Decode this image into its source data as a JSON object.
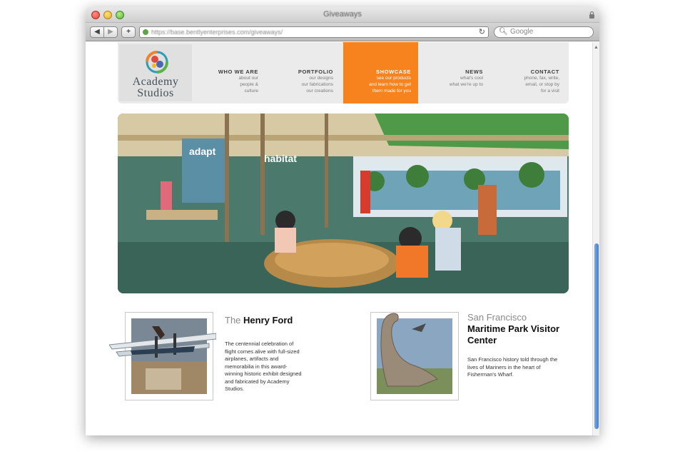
{
  "browser": {
    "window_title": "Giveaways",
    "url": "https://base.bentlyenterprises.com/giveaways/",
    "search_placeholder": "Google",
    "back_glyph": "◀",
    "forward_glyph": "▶",
    "add_glyph": "+",
    "reload_glyph": "↻",
    "search_glyph": "🔍︎"
  },
  "logo": {
    "line1": "Academy",
    "line2": "Studios"
  },
  "nav": [
    {
      "title": "WHO WE ARE",
      "sub": "about our\npeople &\nculture"
    },
    {
      "title": "PORTFOLIO",
      "sub": "our designs\nour fabrications\nour creations"
    },
    {
      "title": "SHOWCASE",
      "sub": "see our products\nand learn how to get\nthem made for you"
    },
    {
      "title": "NEWS",
      "sub": "what's cool\nwhat we're up to"
    },
    {
      "title": "CONTACT",
      "sub": "phone, fax, write,\nemail, or stop by\nfor a visit"
    }
  ],
  "hero": {
    "signs": [
      "adapt",
      "habitat"
    ]
  },
  "features": [
    {
      "title_prefix": "The ",
      "title_main": "Henry Ford",
      "body": "The centennial celebration of flight comes alive with full-sized airplanes, artifacts and memorabilia in this award-winning historic exhibit designed and fabricated by Academy Studios."
    },
    {
      "title_prefix": "San Francisco",
      "title_main": "Maritime Park Visitor Center",
      "body": "San Francisco history told through the lives of Mariners in the heart of Fisherman's Wharf."
    }
  ],
  "colors": {
    "accent": "#f7831f",
    "header_bg": "#ebebeb",
    "scroll_thumb": "#3f7fd8"
  }
}
